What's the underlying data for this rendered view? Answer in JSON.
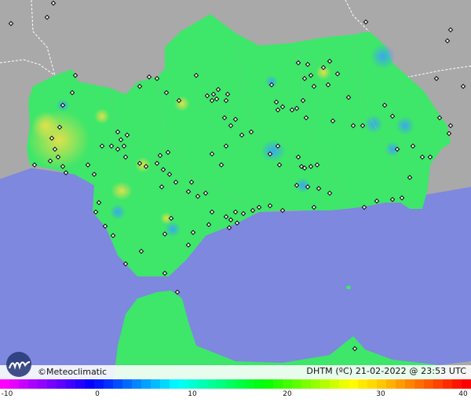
{
  "brand": {
    "name": "Meteoclimatic",
    "symbol": "©"
  },
  "caption": {
    "variable": "DHTM",
    "unit": "(ºC)",
    "date": "21-02-2022",
    "at": "@",
    "time": "23:53",
    "tz": "UTC"
  },
  "scale": {
    "ticks": [
      "-10",
      "0",
      "10",
      "20",
      "30",
      "40"
    ],
    "range": [
      -10,
      40
    ],
    "colors": [
      "#ff00ff",
      "#aa00ff",
      "#5a00ff",
      "#0000ff",
      "#0055ff",
      "#00aaff",
      "#00ffff",
      "#00ffaa",
      "#00ff55",
      "#00ff00",
      "#55ff00",
      "#aaff00",
      "#ffff00",
      "#ffcc00",
      "#ff8800",
      "#ff4400",
      "#ff0000"
    ]
  },
  "colors": {
    "land": "#3ee66a",
    "sea": "#7d88de",
    "outside": "#a9a9a9",
    "station": "#000000",
    "cold_spot": "#3aa0ff",
    "warm_spot": "#e8e04a"
  }
}
